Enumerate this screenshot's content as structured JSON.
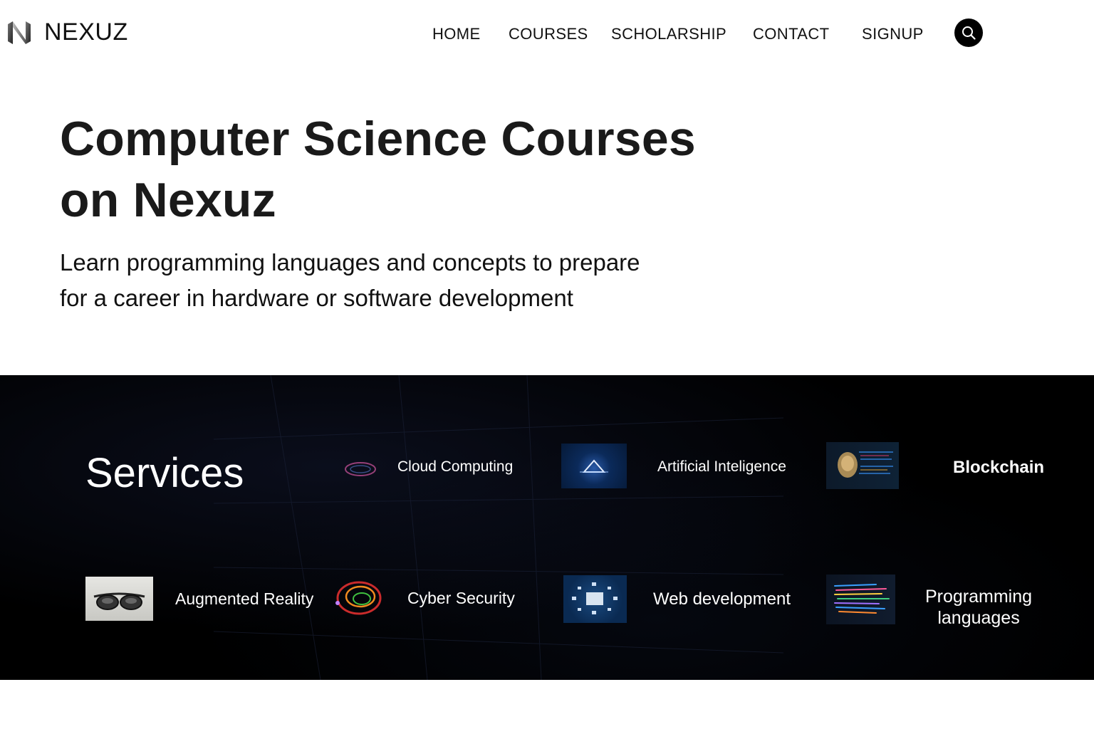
{
  "brand": {
    "name": "NEXUZ"
  },
  "nav": {
    "links": [
      "HOME",
      "COURSES",
      "SCHOLARSHIP",
      "CONTACT",
      "SIGNUP"
    ],
    "search_icon": "search-icon"
  },
  "hero": {
    "title_line1": "Computer Science Courses",
    "title_line2": "on Nexuz",
    "subtitle_line1": "Learn programming languages and concepts to prepare",
    "subtitle_line2": "for a career in hardware or software development"
  },
  "services": {
    "title": "Services",
    "items": [
      {
        "label": "Cloud Computing",
        "icon": "cloud-ring-image"
      },
      {
        "label": "Artificial Inteligence",
        "icon": "ai-triangle-image"
      },
      {
        "label": "Blockchain",
        "icon": "blockchain-head-image"
      },
      {
        "label": "Augmented Reality",
        "icon": "ar-glasses-image"
      },
      {
        "label": "Cyber Security",
        "icon": "cyber-swirl-image"
      },
      {
        "label": "Web development",
        "icon": "web-network-image"
      },
      {
        "label": "Programming",
        "label2": "languages",
        "icon": "code-lines-image"
      }
    ]
  },
  "colors": {
    "accent": "#000000",
    "services_bg": "#000000",
    "text_dark": "#111111",
    "text_light": "#ffffff"
  }
}
